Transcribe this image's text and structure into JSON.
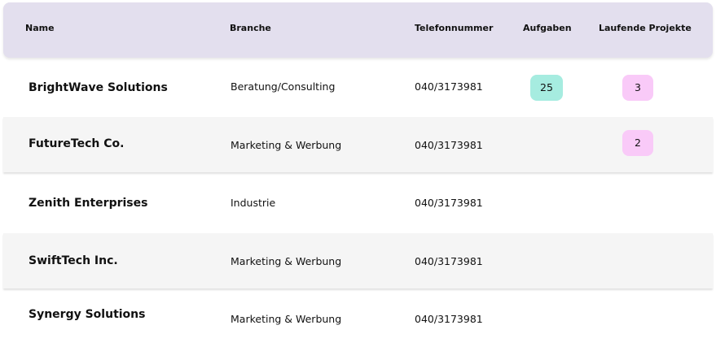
{
  "columns": {
    "name": "Name",
    "branch": "Branche",
    "phone": "Telefonnummer",
    "tasks": "Aufgaben",
    "projects": "Laufende Projekte"
  },
  "rows": [
    {
      "name": "BrightWave Solutions",
      "branch": "Beratung/Consulting",
      "phone": "040/3173981",
      "tasks": "25",
      "projects": "3"
    },
    {
      "name": "FutureTech Co.",
      "branch": "Marketing & Werbung",
      "phone": "040/3173981",
      "tasks": "",
      "projects": "2"
    },
    {
      "name": "Zenith Enterprises",
      "branch": "Industrie",
      "phone": "040/3173981",
      "tasks": "",
      "projects": ""
    },
    {
      "name": "SwiftTech Inc.",
      "branch": "Marketing & Werbung",
      "phone": "040/3173981",
      "tasks": "",
      "projects": ""
    },
    {
      "name": "Synergy Solutions",
      "branch": "Marketing & Werbung",
      "phone": "040/3173981",
      "tasks": "",
      "projects": ""
    }
  ],
  "colors": {
    "header_bg": "#e3dfee",
    "stripe_bg": "#f5f5f5",
    "tasks_badge": "#a6ece0",
    "projects_badge": "#f9caf8"
  }
}
